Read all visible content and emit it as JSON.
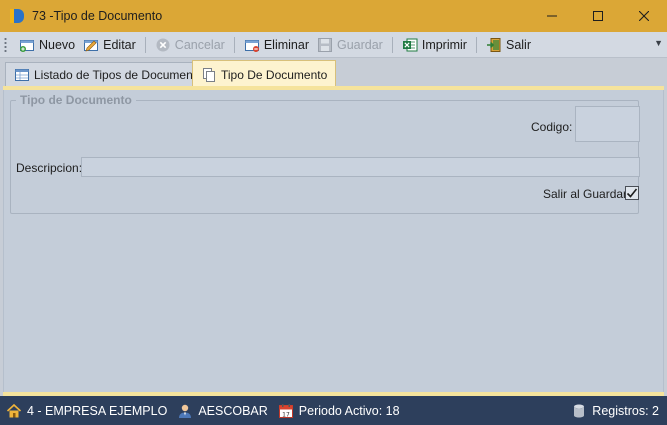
{
  "window": {
    "title": "73 -Tipo de Documento"
  },
  "toolbar": {
    "nuevo": "Nuevo",
    "editar": "Editar",
    "cancelar": "Cancelar",
    "eliminar": "Eliminar",
    "guardar": "Guardar",
    "imprimir": "Imprimir",
    "salir": "Salir"
  },
  "tabs": [
    {
      "label": "Listado de Tipos de Documento",
      "active": false
    },
    {
      "label": "Tipo De Documento",
      "active": true
    }
  ],
  "form": {
    "group_title": "Tipo de Documento",
    "codigo_label": "Codigo:",
    "codigo_value": "",
    "descripcion_label": "Descripcion:",
    "descripcion_value": "",
    "salir_label": "Salir al Guardar",
    "salir_checked": true
  },
  "statusbar": {
    "empresa": "4 - EMPRESA EJEMPLO",
    "usuario": "AESCOBAR",
    "periodo": "Periodo Activo: 18",
    "registros": "Registros: 2"
  },
  "colors": {
    "titlebar": "#dba736",
    "statusbar": "#2d3f5c",
    "active_tab": "#fdf3cf",
    "content": "#c4cdd9"
  }
}
